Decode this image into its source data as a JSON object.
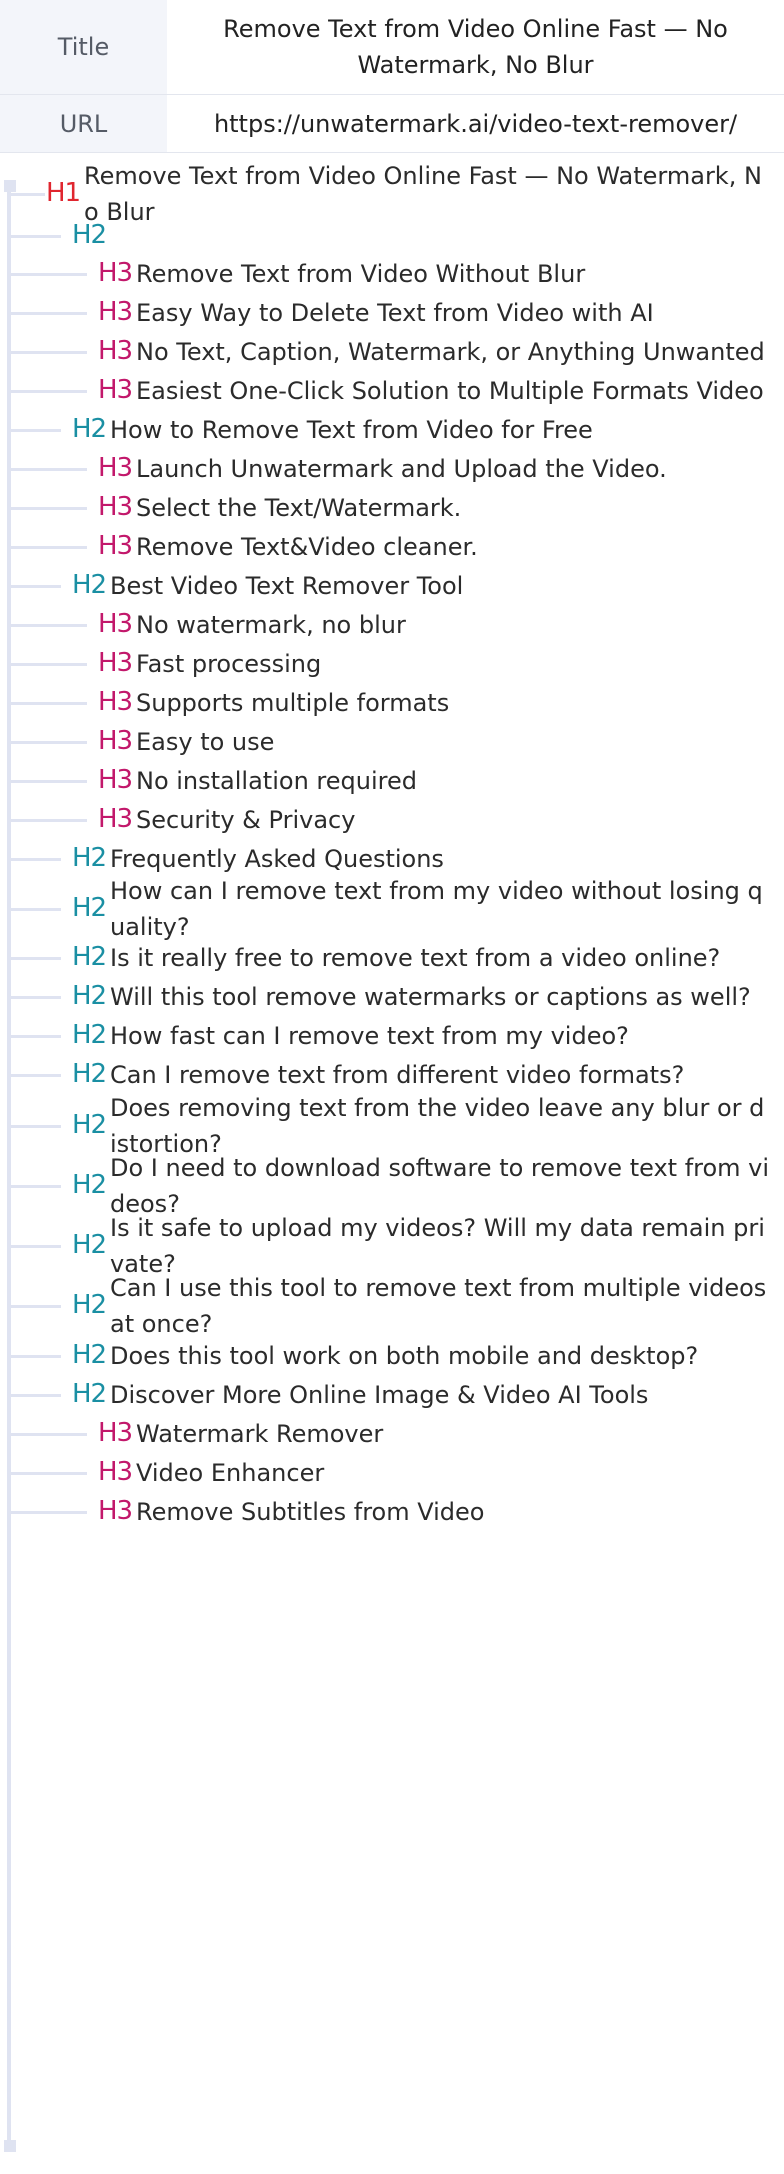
{
  "meta": {
    "title_key": "Title",
    "title_value": "Remove Text from Video Online Fast — No Watermark, No Blur",
    "url_key": "URL",
    "url_value": "https://unwatermark.ai/video-text-remover/"
  },
  "outline": [
    {
      "level": "H1",
      "text": "Remove Text from Video Online Fast — No Watermark, No Blur"
    },
    {
      "level": "H2",
      "text": ""
    },
    {
      "level": "H3",
      "text": "Remove Text from Video Without Blur"
    },
    {
      "level": "H3",
      "text": "Easy Way to Delete Text from Video with AI"
    },
    {
      "level": "H3",
      "text": "No Text, Caption, Watermark, or Anything Unwanted"
    },
    {
      "level": "H3",
      "text": "Easiest One-Click Solution to Multiple Formats Video"
    },
    {
      "level": "H2",
      "text": "How to Remove Text from Video for Free"
    },
    {
      "level": "H3",
      "text": "Launch Unwatermark and Upload the Video."
    },
    {
      "level": "H3",
      "text": "Select the Text/Watermark."
    },
    {
      "level": "H3",
      "text": "Remove Text&Video cleaner."
    },
    {
      "level": "H2",
      "text": "Best Video Text Remover Tool"
    },
    {
      "level": "H3",
      "text": "No watermark, no blur"
    },
    {
      "level": "H3",
      "text": "Fast processing"
    },
    {
      "level": "H3",
      "text": "Supports multiple formats"
    },
    {
      "level": "H3",
      "text": "Easy to use"
    },
    {
      "level": "H3",
      "text": "No installation required"
    },
    {
      "level": "H3",
      "text": "Security & Privacy"
    },
    {
      "level": "H2",
      "text": "Frequently Asked Questions"
    },
    {
      "level": "H2",
      "text": "How can I remove text from my video without losing quality?"
    },
    {
      "level": "H2",
      "text": "Is it really free to remove text from a video online?"
    },
    {
      "level": "H2",
      "text": "Will this tool remove watermarks or captions as well?"
    },
    {
      "level": "H2",
      "text": "How fast can I remove text from my video?"
    },
    {
      "level": "H2",
      "text": "Can I remove text from different video formats?"
    },
    {
      "level": "H2",
      "text": "Does removing text from the video leave any blur or distortion?"
    },
    {
      "level": "H2",
      "text": "Do I need to download software to remove text from videos?"
    },
    {
      "level": "H2",
      "text": "Is it safe to upload my videos? Will my data remain private?"
    },
    {
      "level": "H2",
      "text": "Can I use this tool to remove text from multiple videos at once?"
    },
    {
      "level": "H2",
      "text": "Does this tool work on both mobile and desktop?"
    },
    {
      "level": "H2",
      "text": "Discover More Online Image & Video AI Tools"
    },
    {
      "level": "H3",
      "text": "Watermark Remover"
    },
    {
      "level": "H3",
      "text": "Video Enhancer"
    },
    {
      "level": "H3",
      "text": "Remove Subtitles from Video"
    }
  ],
  "colors": {
    "h1": "#e0262f",
    "h2": "#1a8fa3",
    "h3": "#c2186b",
    "tree_line": "#dfe3f1",
    "meta_key_bg": "#f3f5fa"
  }
}
